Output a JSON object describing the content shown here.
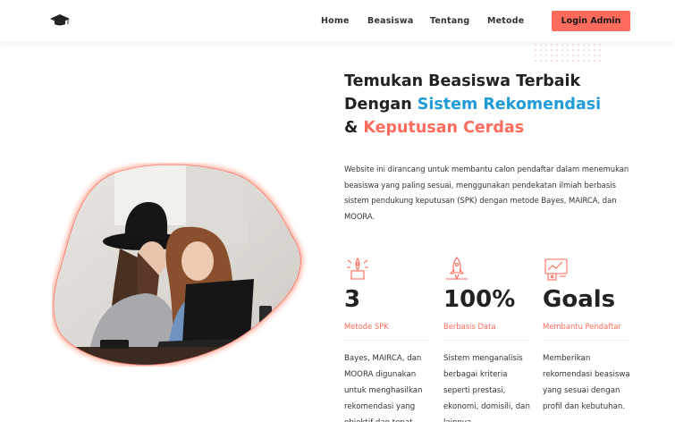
{
  "nav": {
    "logo_icon": "graduation-cap-icon",
    "links": [
      "Home",
      "Beasiswa",
      "Tentang",
      "Metode"
    ],
    "login_label": "Login Admin"
  },
  "hero": {
    "title_line1": "Temukan Beasiswa Terbaik",
    "title_line2_prefix": "Dengan ",
    "title_line2_highlight": "Sistem Rekomendasi",
    "title_line3_prefix": "& ",
    "title_line3_highlight": "Keputusan Cerdas",
    "description": "Website ini dirancang untuk membantu calon pendaftar dalam menemukan beasiswa yang paling sesuai, menggunakan pendekatan ilmiah berbasis sistem pendukung keputusan (SPK) dengan metode Bayes, MAIRCA, dan MOORA."
  },
  "stats": [
    {
      "icon": "rocket-icon",
      "value": "3",
      "label": "Metode SPK",
      "text": "Bayes, MAIRCA, dan MOORA digunakan untuk menghasilkan rekomendasi yang objektif dan tepat."
    },
    {
      "icon": "rocket-icon",
      "value": "100%",
      "label": "Berbasis Data",
      "text": "Sistem menganalisis berbagai kriteria seperti prestasi, ekonomi, domisili, dan lainnya."
    },
    {
      "icon": "dashboard-icon",
      "value": "Goals",
      "label": "Membantu Pendaftar",
      "text": "Memberikan rekomendasi beasiswa yang sesuai dengan profil dan kebutuhan."
    }
  ],
  "colors": {
    "accent": "#ff6b5c",
    "highlight_blue": "#1f9bd7"
  }
}
